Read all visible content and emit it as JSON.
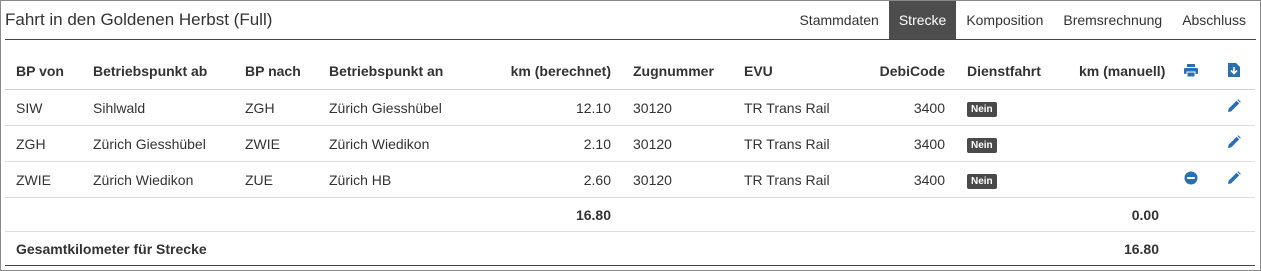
{
  "header": {
    "title": "Fahrt in den Goldenen Herbst (Full)",
    "tabs": [
      {
        "label": "Stammdaten",
        "active": false
      },
      {
        "label": "Strecke",
        "active": true
      },
      {
        "label": "Komposition",
        "active": false
      },
      {
        "label": "Bremsrechnung",
        "active": false
      },
      {
        "label": "Abschluss",
        "active": false
      }
    ]
  },
  "colors": {
    "accent": "#2a6fb0",
    "tab_active_bg": "#4d4d4d",
    "badge_bg": "#4a4a4a"
  },
  "table": {
    "columns": [
      "BP von",
      "Betriebspunkt ab",
      "BP nach",
      "Betriebspunkt an",
      "km (berechnet)",
      "Zugnummer",
      "EVU",
      "DebiCode",
      "Dienstfahrt",
      "km (manuell)"
    ],
    "header_icons": [
      "print-icon",
      "download-icon"
    ],
    "rows": [
      {
        "bp_von": "SIW",
        "ab": "Sihlwald",
        "bp_nach": "ZGH",
        "an": "Zürich Giesshübel",
        "km": "12.10",
        "zug": "30120",
        "evu": "TR Trans Rail",
        "debi": "3400",
        "dienst": "Nein",
        "km_man": "",
        "remove": false
      },
      {
        "bp_von": "ZGH",
        "ab": "Zürich Giesshübel",
        "bp_nach": "ZWIE",
        "an": "Zürich Wiedikon",
        "km": "2.10",
        "zug": "30120",
        "evu": "TR Trans Rail",
        "debi": "3400",
        "dienst": "Nein",
        "km_man": "",
        "remove": false
      },
      {
        "bp_von": "ZWIE",
        "ab": "Zürich Wiedikon",
        "bp_nach": "ZUE",
        "an": "Zürich HB",
        "km": "2.60",
        "zug": "30120",
        "evu": "TR Trans Rail",
        "debi": "3400",
        "dienst": "Nein",
        "km_man": "",
        "remove": true
      }
    ],
    "sum": {
      "km_berechnet": "16.80",
      "km_manuell": "0.00"
    },
    "total": {
      "label": "Gesamtkilometer für Strecke",
      "value": "16.80"
    }
  }
}
